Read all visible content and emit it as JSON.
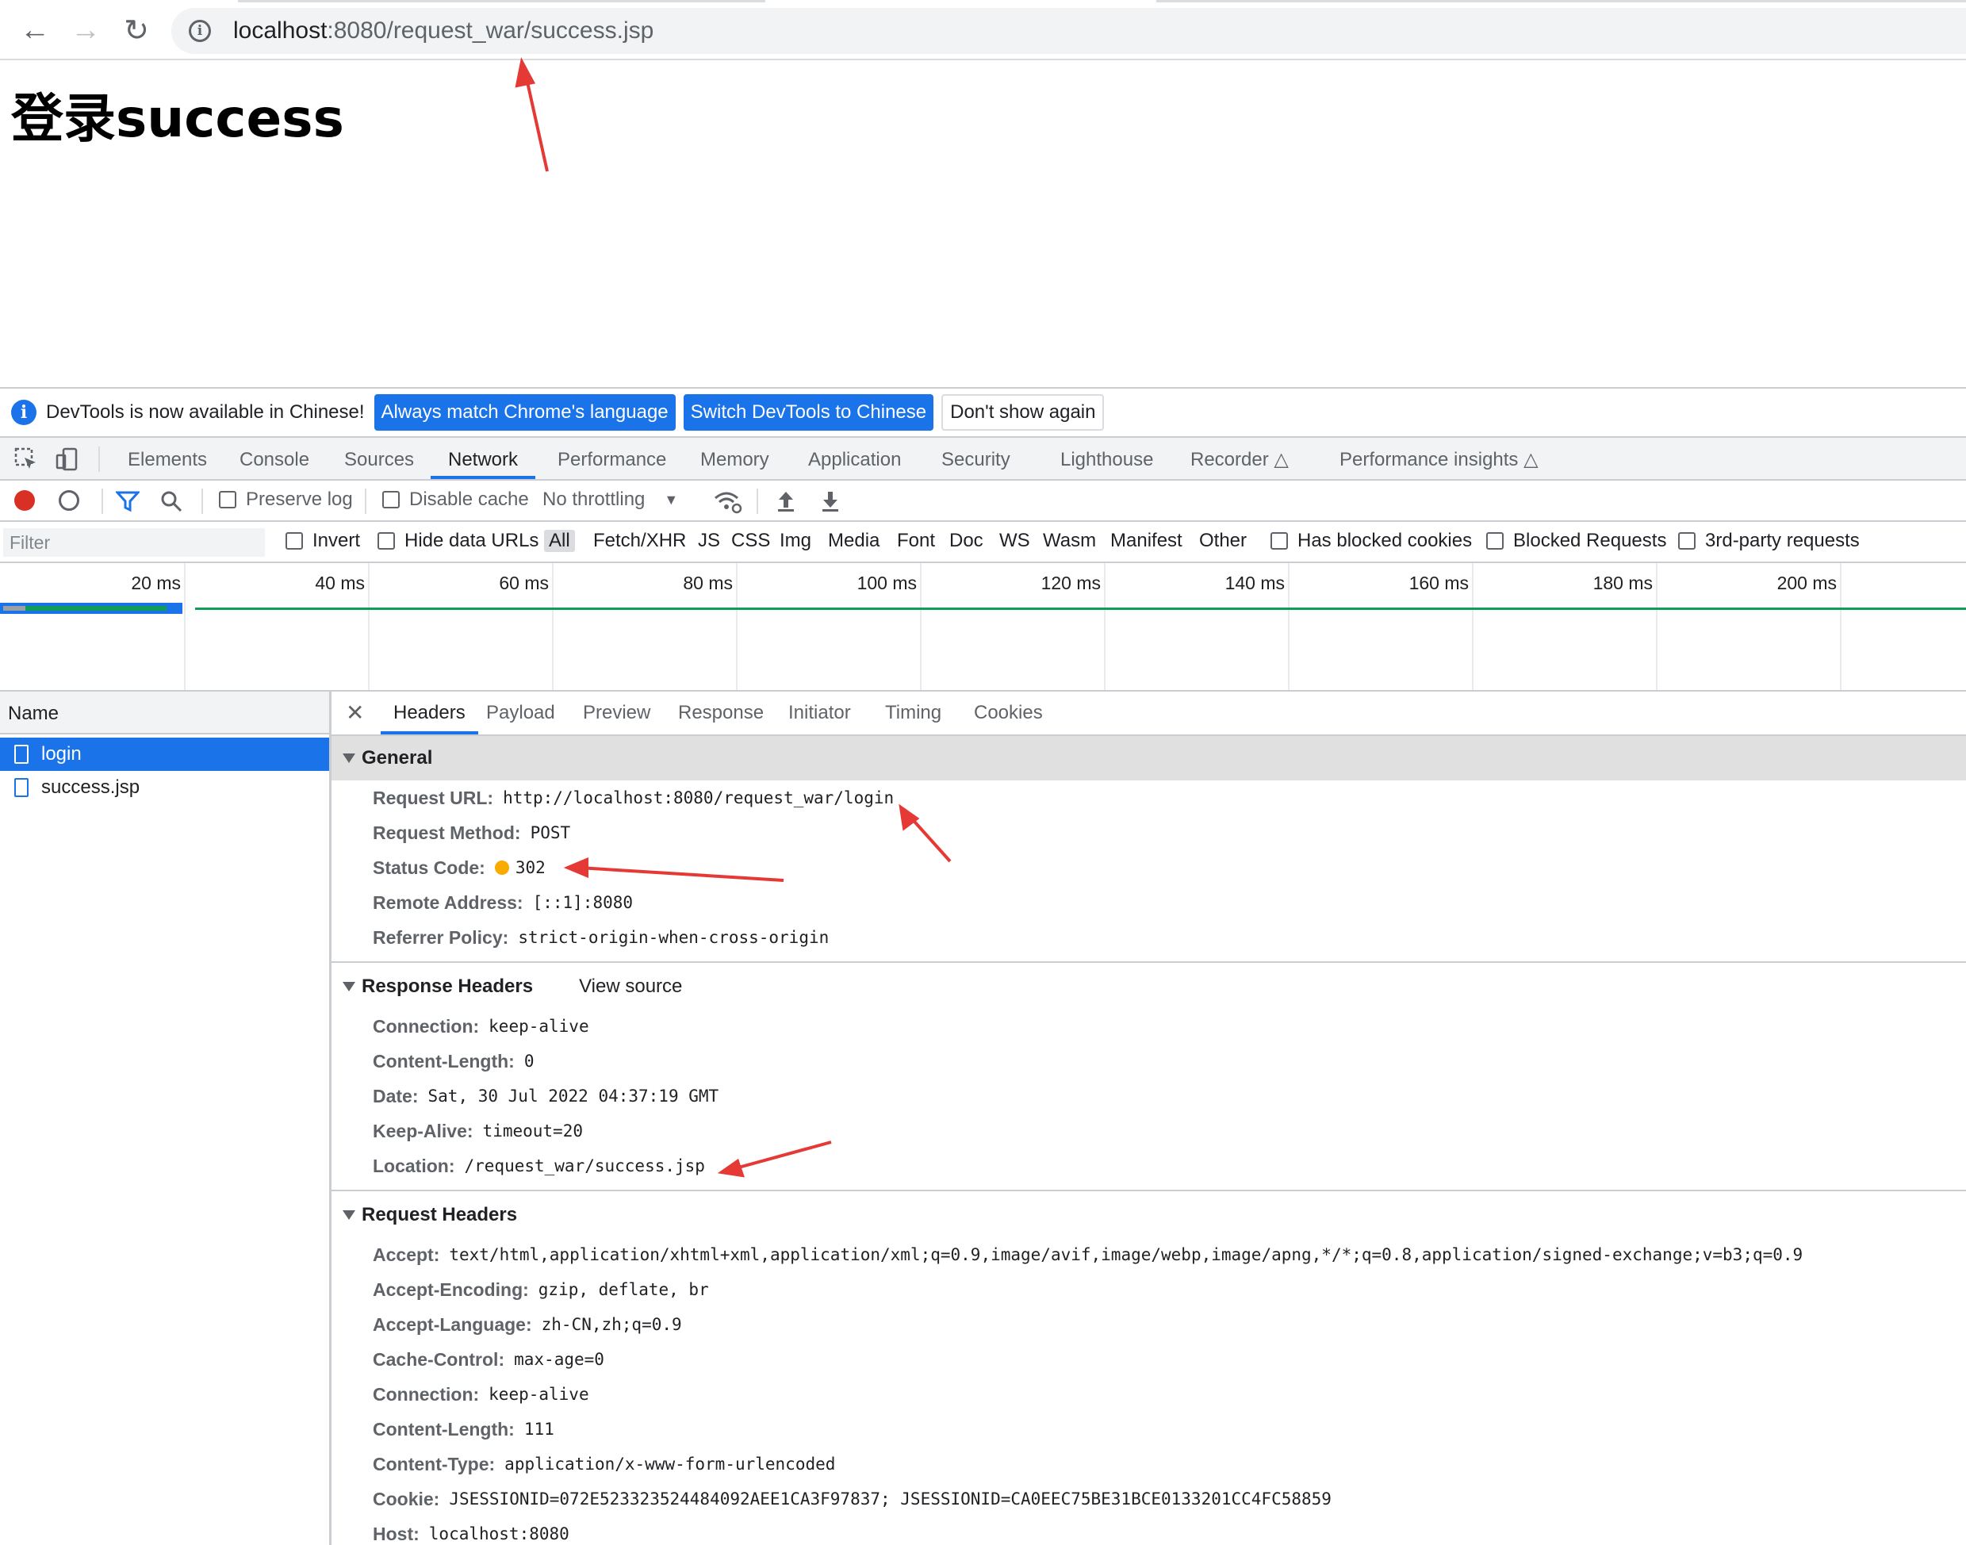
{
  "browser": {
    "url_host": "localhost",
    "url_rest": ":8080/request_war/success.jsp"
  },
  "page": {
    "title": "登录success"
  },
  "infobar": {
    "message": "DevTools is now available in Chinese!",
    "btn_match": "Always match Chrome's language",
    "btn_switch": "Switch DevTools to Chinese",
    "btn_dont_show": "Don't show again"
  },
  "devtools_tabs": [
    "Elements",
    "Console",
    "Sources",
    "Network",
    "Performance",
    "Memory",
    "Application",
    "Security",
    "Lighthouse",
    "Recorder",
    "Performance insights"
  ],
  "toolbar": {
    "preserve_log": "Preserve log",
    "disable_cache": "Disable cache",
    "throttling": "No throttling"
  },
  "filterbar": {
    "placeholder": "Filter",
    "invert": "Invert",
    "hide_data_urls": "Hide data URLs",
    "types": [
      "All",
      "Fetch/XHR",
      "JS",
      "CSS",
      "Img",
      "Media",
      "Font",
      "Doc",
      "WS",
      "Wasm",
      "Manifest",
      "Other"
    ],
    "has_blocked_cookies": "Has blocked cookies",
    "blocked_requests": "Blocked Requests",
    "third_party": "3rd-party requests"
  },
  "timeline": {
    "ticks": [
      "20 ms",
      "40 ms",
      "60 ms",
      "80 ms",
      "100 ms",
      "120 ms",
      "140 ms",
      "160 ms",
      "180 ms",
      "200 ms"
    ]
  },
  "requests": {
    "header": "Name",
    "items": [
      "login",
      "success.jsp"
    ]
  },
  "detail_tabs": [
    "Headers",
    "Payload",
    "Preview",
    "Response",
    "Initiator",
    "Timing",
    "Cookies"
  ],
  "general": {
    "title": "General",
    "rows": [
      {
        "k": "Request URL:",
        "v": "http://localhost:8080/request_war/login"
      },
      {
        "k": "Request Method:",
        "v": "POST"
      },
      {
        "k": "Status Code:",
        "v": "302"
      },
      {
        "k": "Remote Address:",
        "v": "[::1]:8080"
      },
      {
        "k": "Referrer Policy:",
        "v": "strict-origin-when-cross-origin"
      }
    ]
  },
  "response_headers": {
    "title": "Response Headers",
    "view_source": "View source",
    "rows": [
      {
        "k": "Connection:",
        "v": "keep-alive"
      },
      {
        "k": "Content-Length:",
        "v": "0"
      },
      {
        "k": "Date:",
        "v": "Sat, 30 Jul 2022 04:37:19 GMT"
      },
      {
        "k": "Keep-Alive:",
        "v": "timeout=20"
      },
      {
        "k": "Location:",
        "v": "/request_war/success.jsp"
      }
    ]
  },
  "request_headers": {
    "title": "Request Headers",
    "rows": [
      {
        "k": "Accept:",
        "v": "text/html,application/xhtml+xml,application/xml;q=0.9,image/avif,image/webp,image/apng,*/*;q=0.8,application/signed-exchange;v=b3;q=0.9"
      },
      {
        "k": "Accept-Encoding:",
        "v": "gzip, deflate, br"
      },
      {
        "k": "Accept-Language:",
        "v": "zh-CN,zh;q=0.9"
      },
      {
        "k": "Cache-Control:",
        "v": "max-age=0"
      },
      {
        "k": "Connection:",
        "v": "keep-alive"
      },
      {
        "k": "Content-Length:",
        "v": "111"
      },
      {
        "k": "Content-Type:",
        "v": "application/x-www-form-urlencoded"
      },
      {
        "k": "Cookie:",
        "v": "JSESSIONID=072E523323524484092AEE1CA3F97837; JSESSIONID=CA0EEC75BE31BCE0133201CC4FC58859"
      },
      {
        "k": "Host:",
        "v": "localhost:8080"
      }
    ]
  },
  "colors": {
    "accent": "#1a73e8",
    "arrow": "#e53935",
    "status_302": "#f9ab00"
  }
}
